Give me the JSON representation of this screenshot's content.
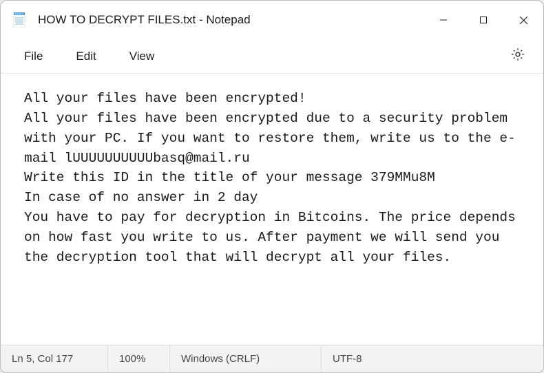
{
  "window": {
    "title": "HOW TO DECRYPT FILES.txt - Notepad"
  },
  "menubar": {
    "file": "File",
    "edit": "Edit",
    "view": "View"
  },
  "content": {
    "text": "All your files have been encrypted!\nAll your files have been encrypted due to a security problem with your PC. If you want to restore them, write us to the e-mail lUUUUUUUUUUbasq@mail.ru\nWrite this ID in the title of your message 379MMu8M\nIn case of no answer in 2 day\nYou have to pay for decryption in Bitcoins. The price depends on how fast you write to us. After payment we will send you the decryption tool that will decrypt all your files."
  },
  "statusbar": {
    "position": "Ln 5, Col 177",
    "zoom": "100%",
    "eol": "Windows (CRLF)",
    "encoding": "UTF-8"
  }
}
